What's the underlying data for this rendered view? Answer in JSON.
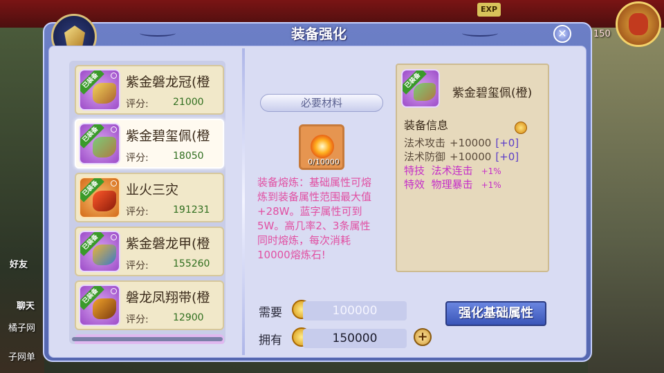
{
  "background": {
    "exp_label": "EXP",
    "side_labels": [
      "好友",
      "聊天",
      "橘子网",
      "子网单"
    ],
    "right_label": "150"
  },
  "panel": {
    "title": "装备强化",
    "close_symbol": "✕"
  },
  "equipment_list": {
    "score_label": "评分:",
    "equipped_tag": "已装备",
    "items": [
      {
        "name": "紫金磐龙冠(橙",
        "score": "21000",
        "rarity": "purple"
      },
      {
        "name": "紫金碧玺佩(橙",
        "score": "18050",
        "rarity": "purple",
        "selected": true
      },
      {
        "name": "业火三灾",
        "score": "191231",
        "rarity": "orange"
      },
      {
        "name": "紫金磐龙甲(橙",
        "score": "155260",
        "rarity": "purple"
      },
      {
        "name": "磐龙凤翔带(橙",
        "score": "12900",
        "rarity": "purple"
      }
    ]
  },
  "materials": {
    "header": "必要材料",
    "slot_count": "0/10000",
    "description": "装备熔炼：基础属性可熔炼到装备属性范围最大值+28W。蓝字属性可到5W。高几率2、3条属性同时熔炼，每次消耗10000熔炼石!"
  },
  "info": {
    "equipped_tag": "已装备",
    "name": "紫金碧玺佩(橙)",
    "section_title": "装备信息",
    "attributes": [
      {
        "name": "法术攻击",
        "value": "+10000",
        "bonus": "[+0]"
      },
      {
        "name": "法术防御",
        "value": "+10000",
        "bonus": "[+0]"
      }
    ],
    "specials": [
      {
        "type": "特技",
        "name": "法术连击",
        "value": "+1%"
      },
      {
        "type": "特效",
        "name": "物理暴击",
        "value": "+1%"
      }
    ]
  },
  "cost": {
    "need_label": "需要",
    "need_amount": "100000",
    "have_label": "拥有",
    "have_amount": "150000",
    "plus_symbol": "+"
  },
  "actions": {
    "enhance_label": "强化基础属性"
  },
  "colors": {
    "description_pink": "#e14fa2",
    "special_magenta": "#c52ec8",
    "bonus_blue": "#5a3cc8",
    "score_green": "#2f6e1e"
  }
}
